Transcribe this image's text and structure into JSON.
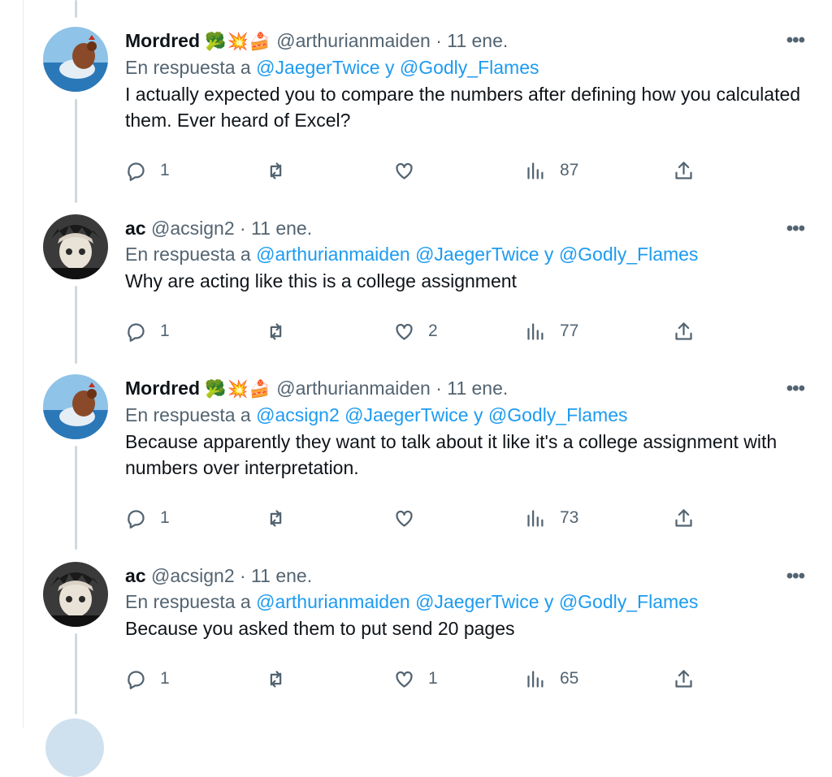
{
  "tweets": [
    {
      "name": "Mordred",
      "emojis": "🥦💥🍰",
      "handle": "@arthurianmaiden",
      "date": "· 11 ene.",
      "reply_prefix": "En respuesta a",
      "mentions": [
        "@JaegerTwice",
        "@Godly_Flames"
      ],
      "conjunction": "y",
      "text": "I actually expected you to compare the numbers after defining how you calculated them. Ever heard of Excel?",
      "replies": "1",
      "retweets": "",
      "likes": "",
      "views": "87"
    },
    {
      "name": "ac",
      "emojis": "",
      "handle": "@acsign2",
      "date": "· 11 ene.",
      "reply_prefix": "En respuesta a",
      "mentions": [
        "@arthurianmaiden",
        "@JaegerTwice",
        "@Godly_Flames"
      ],
      "conjunction": "y",
      "text": "Why are acting like this is a college assignment",
      "replies": "1",
      "retweets": "",
      "likes": "2",
      "views": "77"
    },
    {
      "name": "Mordred",
      "emojis": "🥦💥🍰",
      "handle": "@arthurianmaiden",
      "date": "· 11 ene.",
      "reply_prefix": "En respuesta a",
      "mentions": [
        "@acsign2",
        "@JaegerTwice",
        "@Godly_Flames"
      ],
      "conjunction": "y",
      "text": "Because apparently they want to talk about it like it's a college assignment with numbers over interpretation.",
      "replies": "1",
      "retweets": "",
      "likes": "",
      "views": "73"
    },
    {
      "name": "ac",
      "emojis": "",
      "handle": "@acsign2",
      "date": "· 11 ene.",
      "reply_prefix": "En respuesta a",
      "mentions": [
        "@arthurianmaiden",
        "@JaegerTwice",
        "@Godly_Flames"
      ],
      "conjunction": "y",
      "text": "Because you asked them to put send 20 pages",
      "replies": "1",
      "retweets": "",
      "likes": "1",
      "views": "65"
    }
  ],
  "more_label": "•••",
  "colors": {
    "link": "#1d9bf0",
    "muted": "#536471",
    "text": "#0f1419",
    "thread_line": "#cfd9de"
  },
  "icons": [
    "reply-icon",
    "retweet-icon",
    "like-icon",
    "views-icon",
    "share-icon",
    "more-icon"
  ]
}
